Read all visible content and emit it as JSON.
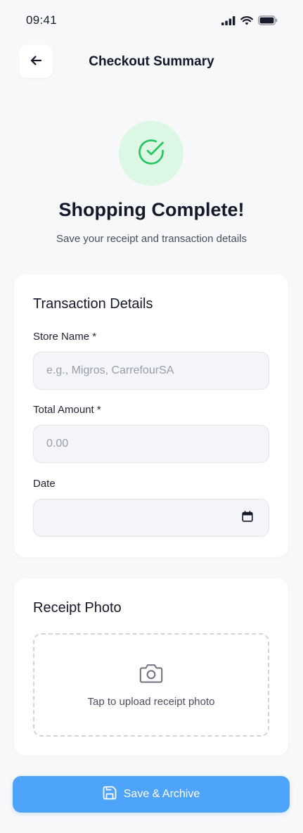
{
  "status_bar": {
    "time": "09:41"
  },
  "header": {
    "title": "Checkout Summary"
  },
  "success": {
    "title": "Shopping Complete!",
    "subtitle": "Save your receipt and transaction details"
  },
  "transaction": {
    "title": "Transaction Details",
    "store_label": "Store Name *",
    "store_placeholder": "e.g., Migros, CarrefourSA",
    "store_value": "",
    "amount_label": "Total Amount *",
    "amount_placeholder": "0.00",
    "amount_value": "",
    "date_label": "Date",
    "date_value": ""
  },
  "receipt": {
    "title": "Receipt Photo",
    "upload_text": "Tap to upload receipt photo"
  },
  "actions": {
    "save_label": "Save & Archive"
  },
  "colors": {
    "accent": "#4ea3fb",
    "success": "#22c55e",
    "success_bg": "#dcf7e3",
    "background": "#f7f8fa"
  }
}
